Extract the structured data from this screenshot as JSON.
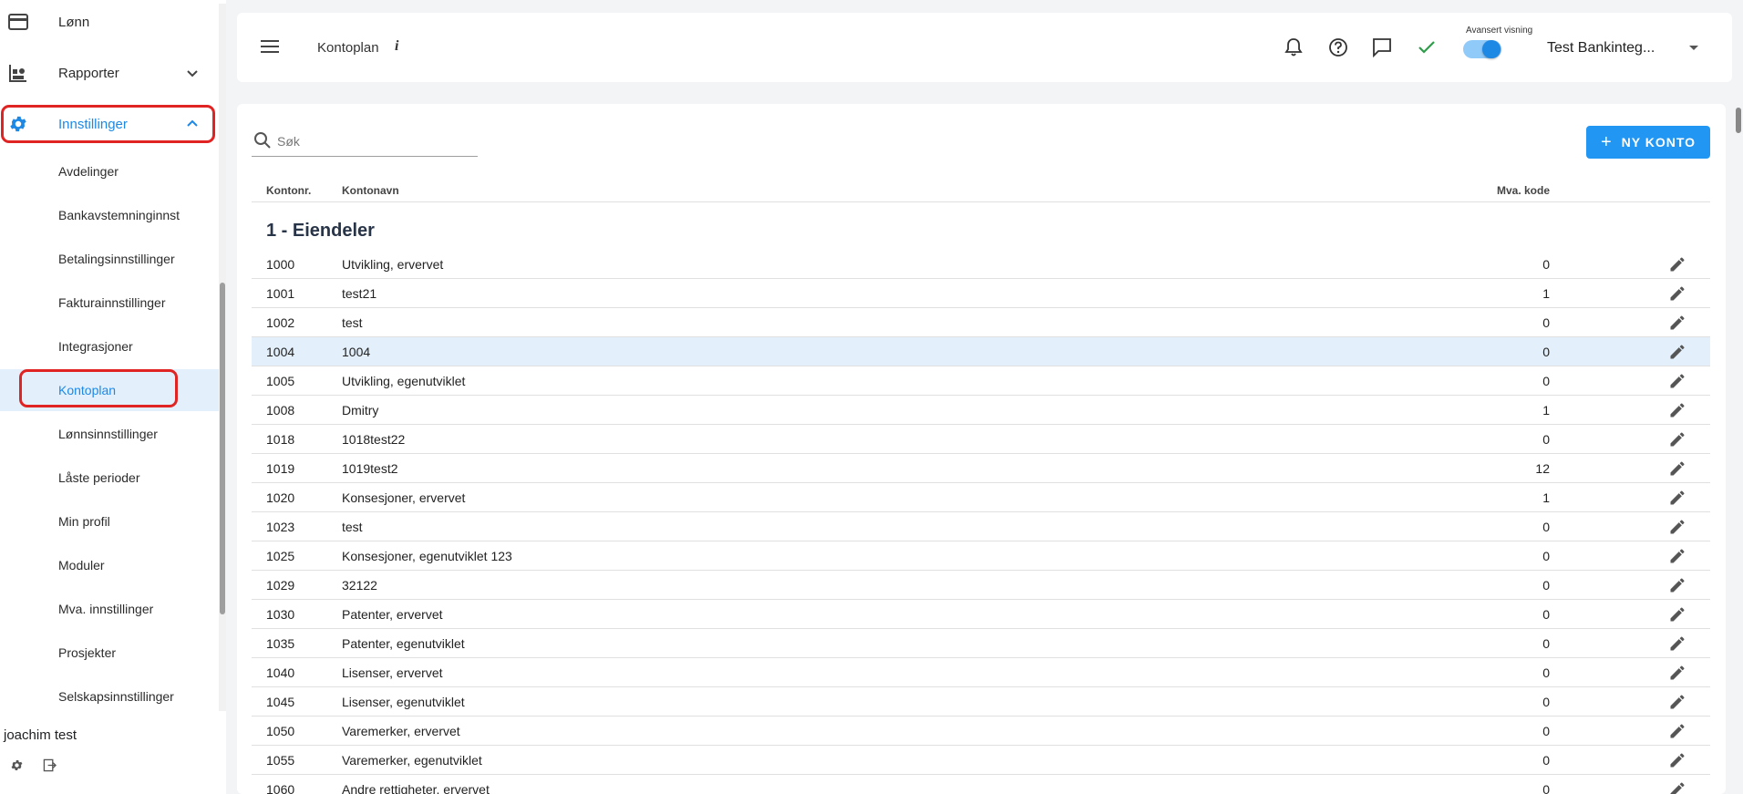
{
  "sidebar": {
    "items": [
      {
        "label": "Lønn",
        "icon": "card-icon"
      },
      {
        "label": "Rapporter",
        "icon": "report-icon"
      },
      {
        "label": "Innstillinger",
        "icon": "gear-icon"
      }
    ],
    "subitems": [
      "Avdelinger",
      "Bankavstemninginnst",
      "Betalingsinnstillinger",
      "Fakturainnstillinger",
      "Integrasjoner",
      "Kontoplan",
      "Lønnsinnstillinger",
      "Låste perioder",
      "Min profil",
      "Moduler",
      "Mva. innstillinger",
      "Prosjekter",
      "Selskapsinnstillinger"
    ],
    "selected": "Kontoplan",
    "user": "joachim test"
  },
  "header": {
    "title": "Kontoplan",
    "info": "i",
    "advanced_label": "Avansert visning",
    "advanced_on": true,
    "company": "Test Bankinteg..."
  },
  "main": {
    "search_placeholder": "Søk",
    "new_button": "NY KONTO",
    "columns": {
      "nr": "Kontonr.",
      "name": "Kontonavn",
      "mva": "Mva. kode"
    },
    "group_title": "1 - Eiendeler",
    "rows": [
      {
        "nr": "1000",
        "name": "Utvikling, ervervet",
        "mva": "0"
      },
      {
        "nr": "1001",
        "name": "test21",
        "mva": "1"
      },
      {
        "nr": "1002",
        "name": "test",
        "mva": "0"
      },
      {
        "nr": "1004",
        "name": "1004",
        "mva": "0"
      },
      {
        "nr": "1005",
        "name": "Utvikling, egenutviklet",
        "mva": "0"
      },
      {
        "nr": "1008",
        "name": "Dmitry",
        "mva": "1"
      },
      {
        "nr": "1018",
        "name": "1018test22",
        "mva": "0"
      },
      {
        "nr": "1019",
        "name": "1019test2",
        "mva": "12"
      },
      {
        "nr": "1020",
        "name": "Konsesjoner, ervervet",
        "mva": "1"
      },
      {
        "nr": "1023",
        "name": "test",
        "mva": "0"
      },
      {
        "nr": "1025",
        "name": "Konsesjoner, egenutviklet 123",
        "mva": "0"
      },
      {
        "nr": "1029",
        "name": "32122",
        "mva": "0"
      },
      {
        "nr": "1030",
        "name": "Patenter, ervervet",
        "mva": "0"
      },
      {
        "nr": "1035",
        "name": "Patenter, egenutviklet",
        "mva": "0"
      },
      {
        "nr": "1040",
        "name": "Lisenser, ervervet",
        "mva": "0"
      },
      {
        "nr": "1045",
        "name": "Lisenser, egenutviklet",
        "mva": "0"
      },
      {
        "nr": "1050",
        "name": "Varemerker, ervervet",
        "mva": "0"
      },
      {
        "nr": "1055",
        "name": "Varemerker, egenutviklet",
        "mva": "0"
      },
      {
        "nr": "1060",
        "name": "Andre rettigheter, ervervet",
        "mva": "0"
      }
    ],
    "highlighted_row": "1004"
  },
  "colors": {
    "accent": "#1e88e5",
    "button": "#2196f3",
    "highlight": "#e3f0fb",
    "annotation": "#e02424",
    "check": "#2e9d4a"
  }
}
